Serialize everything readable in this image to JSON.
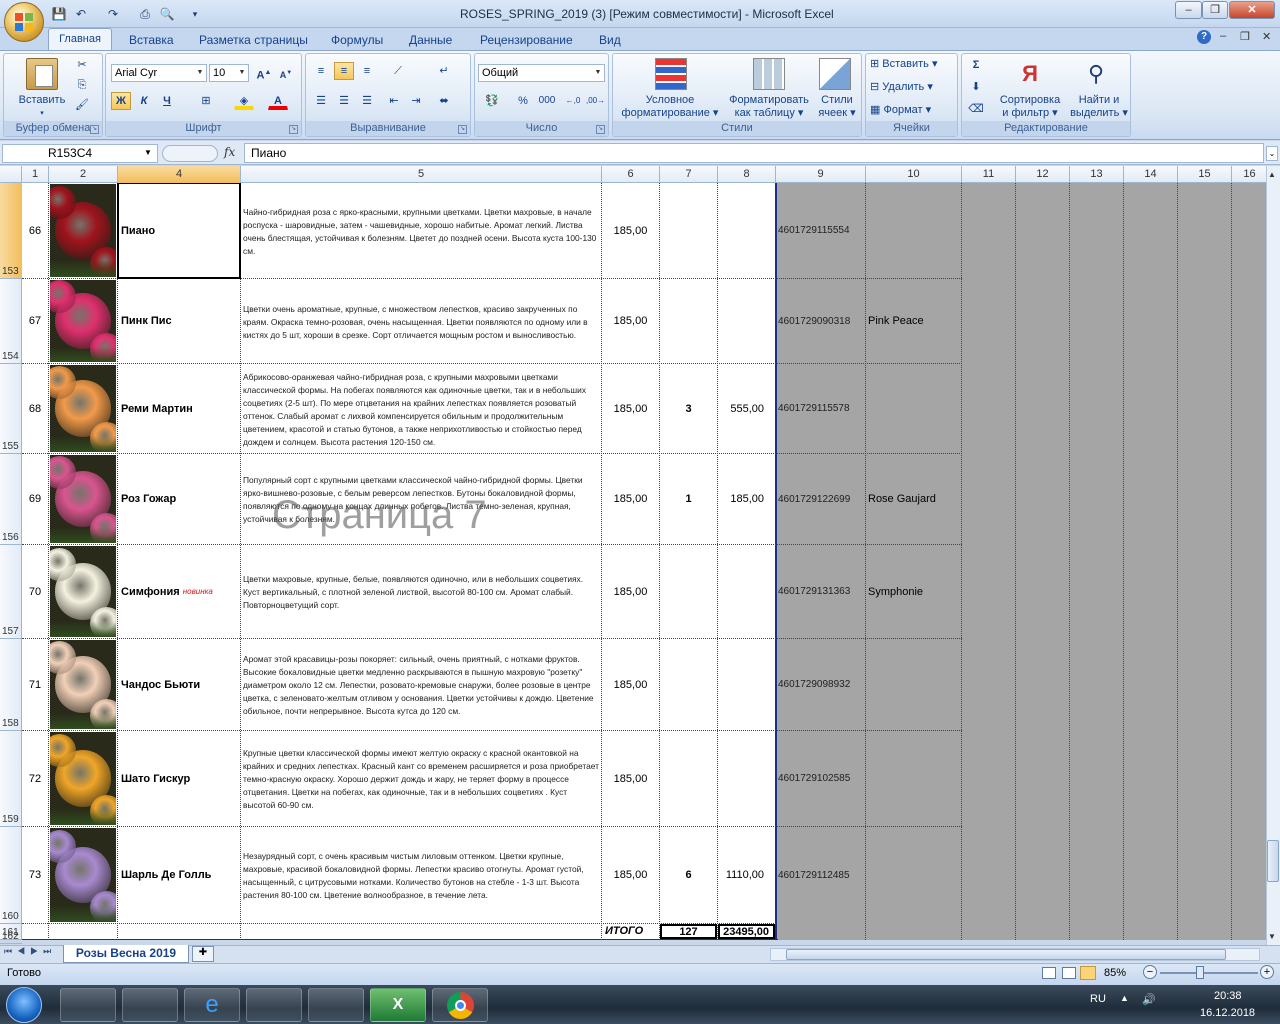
{
  "window": {
    "title": "ROSES_SPRING_2019 (3)  [Режим совместимости] - Microsoft Excel"
  },
  "ribbon": {
    "tabs": [
      "Главная",
      "Вставка",
      "Разметка страницы",
      "Формулы",
      "Данные",
      "Рецензирование",
      "Вид"
    ],
    "active_tab": "Главная",
    "clipboard": {
      "label": "Буфер обмена",
      "paste": "Вставить"
    },
    "font": {
      "label": "Шрифт",
      "name": "Arial Cyr",
      "size": "10",
      "bold": "Ж",
      "italic": "К",
      "underline": "Ч"
    },
    "alignment": {
      "label": "Выравнивание"
    },
    "number": {
      "label": "Число",
      "format": "Общий",
      "percent": "%",
      "thousands": "000"
    },
    "styles": {
      "label": "Стили",
      "cond_format_1": "Условное",
      "cond_format_2": "форматирование",
      "format_table_1": "Форматировать",
      "format_table_2": "как таблицу",
      "cell_styles_1": "Стили",
      "cell_styles_2": "ячеек"
    },
    "cells": {
      "label": "Ячейки",
      "insert": "Вставить",
      "delete": "Удалить",
      "format": "Формат"
    },
    "editing": {
      "label": "Редактирование",
      "sigma": "Σ",
      "sort_1": "Сортировка",
      "sort_2": "и фильтр",
      "find_1": "Найти и",
      "find_2": "выделить"
    }
  },
  "formula_bar": {
    "name_box": "R153C4",
    "fx": "fx",
    "value": "Пиано"
  },
  "columns": [
    "1",
    "2",
    "4",
    "5",
    "6",
    "7",
    "8",
    "9",
    "10",
    "11",
    "12",
    "13",
    "14",
    "15",
    "16"
  ],
  "rows": [
    {
      "row": "153",
      "num": "66",
      "name": "Пиано",
      "badge": "",
      "desc": "Чайно-гибридная роза с ярко-красными, крупными цветками. Цветки махровые, в начале роспуска - шаровидные, затем - чашевидные, хорошо набитые. Аромат легкий. Листва очень блестящая, устойчивая к болезням. Цветет до поздней осени. Высота куста 100-130 см.",
      "price": "185,00",
      "qty": "",
      "sum": "",
      "code": "4601729115554",
      "eng": "",
      "color": "#a0141e"
    },
    {
      "row": "154",
      "num": "67",
      "name": "Пинк Пис",
      "badge": "",
      "desc": "Цветки очень ароматные, крупные, с множеством лепестков, красиво закрученных по краям. Окраска темно-розовая, очень насыщенная. Цветки появляются по одному или в кистях до 5 шт, хороши в срезке. Сорт отличается мощным ростом и выносливостью.",
      "price": "185,00",
      "qty": "",
      "sum": "",
      "code": "4601729090318",
      "eng": "Pink Peace",
      "color": "#e0306e"
    },
    {
      "row": "155",
      "num": "68",
      "name": "Реми Мартин",
      "badge": "",
      "desc": "Абрикосово-оранжевая чайно-гибридная роза, с крупными махровыми цветками классической формы. На побегах появляются как одиночные цветки, так и в небольших соцветиях (2-5 шт). По мере отцветания на крайних лепестках появляется розоватый оттенок. Слабый аромат с лихвой компенсируется обильным и продолжительным цветением, красотой и статью бутонов, а также неприхотливостью и стойкостью перед дождем и солнцем. Высота растения 120-150 см.",
      "price": "185,00",
      "qty": "3",
      "sum": "555,00",
      "code": "4601729115578",
      "eng": "",
      "color": "#f29a4a"
    },
    {
      "row": "156",
      "num": "69",
      "name": "Роз Гожар",
      "badge": "",
      "desc": "Популярный сорт с крупными цветками классической чайно-гибридной формы. Цветки ярко-вишнево-розовые, с белым реверсом лепестков. Бутоны бокаловидной формы, появляются по одному на концах длинных побегов. Листва темно-зеленая, крупная, устойчивая к болезням.",
      "price": "185,00",
      "qty": "1",
      "sum": "185,00",
      "code": "4601729122699",
      "eng": "Rose Gaujard",
      "color": "#d9558f"
    },
    {
      "row": "157",
      "num": "70",
      "name": "Симфония",
      "badge": "новинка",
      "desc": "Цветки махровые, крупные, белые, появляются одиночно, или в небольших соцветиях. Куст вертикальный, с плотной зеленой листвой, высотой 80-100 см. Аромат слабый. Повторноцветущий сорт.",
      "price": "185,00",
      "qty": "",
      "sum": "",
      "code": "4601729131363",
      "eng": "Symphonie",
      "color": "#f4f1df"
    },
    {
      "row": "158",
      "num": "71",
      "name": "Чандос Бьюти",
      "badge": "",
      "desc": "Аромат этой красавицы-розы покоряет: сильный, очень приятный, с нотками фруктов. Высокие бокаловидные цветки медленно раскрываются в пышную махровую \"розетку\" диаметром  около 12 см. Лепестки, розовато-кремовые снаружи, более розовые в центре цветка, с зеленовато-желтым отливом у основания. Цветки устойчивы к дождю. Цветение обильное, почти непрерывное. Высота кутса до 120 см.",
      "price": "185,00",
      "qty": "",
      "sum": "",
      "code": "4601729098932",
      "eng": "",
      "color": "#f2d0b8"
    },
    {
      "row": "159",
      "num": "72",
      "name": "Шато Гискур",
      "badge": "",
      "desc": "Крупные цветки классической формы имеют желтую окраску с красной окантовкой на крайних и средних лепестках. Красный кант со временем расширяется и роза приобретает темно-красную окраску. Хорошо держит дождь и жару, не теряет форму в процессе отцветания. Цветки на побегах, как одиночные, так и в небольших соцветиях . Куст высотой 60-90 см.",
      "price": "185,00",
      "qty": "",
      "sum": "",
      "code": "4601729102585",
      "eng": "",
      "color": "#f0a628"
    },
    {
      "row": "160",
      "num": "73",
      "name": "Шарль Де Голль",
      "badge": "",
      "desc": "Незаурядный сорт, с очень красивым чистым лиловым оттенком. Цветки крупные, махровые, красивой бокаловидной формы. Лепестки красиво отогнуты. Аромат густой, насыщенный, с цитрусовыми нотками. Количество бутонов на стебле - 1-3 шт. Высота растения 80-100 см. Цветение волнообразное, в течение лета.",
      "price": "185,00",
      "qty": "6",
      "sum": "1110,00",
      "code": "4601729112485",
      "eng": "",
      "color": "#a88ad0"
    }
  ],
  "totals": {
    "row": "161",
    "label": "ИТОГО",
    "qty": "127",
    "sum": "23495,00",
    "next_row": "162"
  },
  "watermark": "Страница 7",
  "sheet_tab": "Розы Весна 2019",
  "status": {
    "ready": "Готово",
    "zoom": "85%"
  },
  "taskbar": {
    "lang": "RU",
    "time": "20:38",
    "date": "16.12.2018"
  }
}
